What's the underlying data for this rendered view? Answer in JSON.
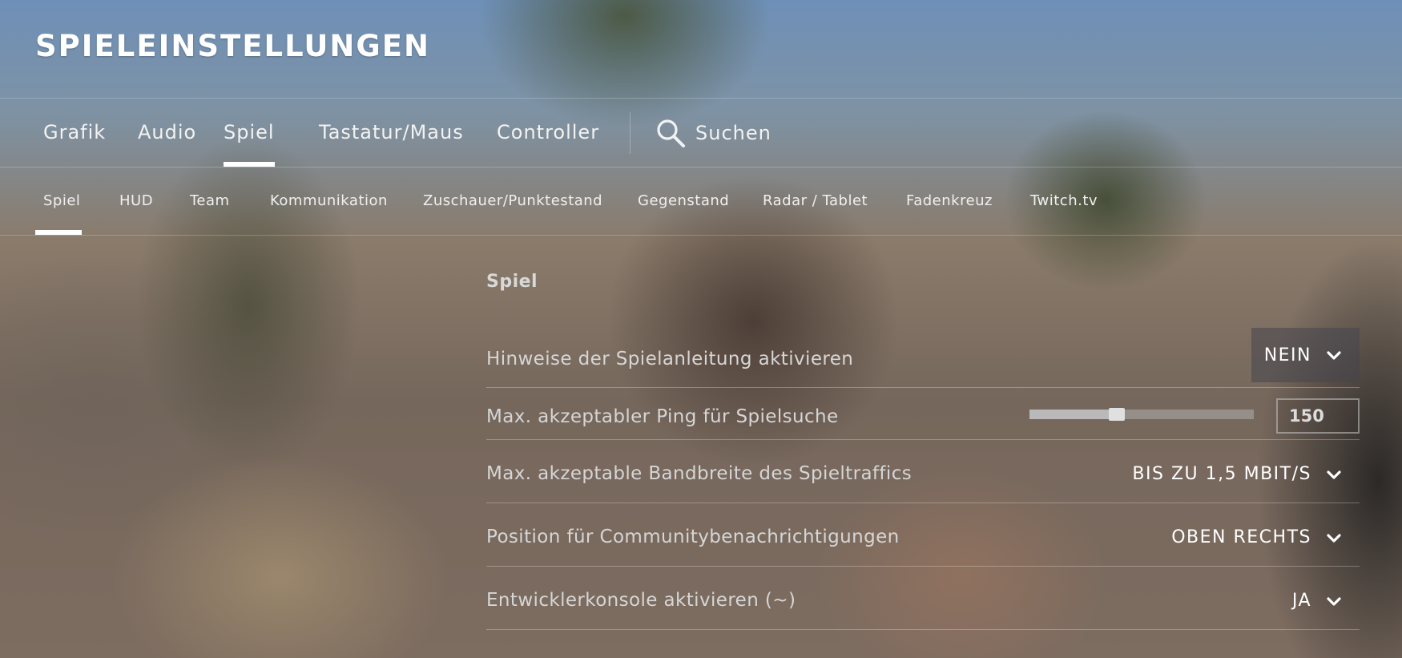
{
  "header": {
    "title": "SPIELEINSTELLUNGEN"
  },
  "main_tabs": [
    {
      "label": "Grafik",
      "active": false
    },
    {
      "label": "Audio",
      "active": false
    },
    {
      "label": "Spiel",
      "active": true
    },
    {
      "label": "Tastatur/Maus",
      "active": false
    },
    {
      "label": "Controller",
      "active": false
    }
  ],
  "search": {
    "label": "Suchen",
    "icon": "search-icon"
  },
  "sub_tabs": [
    {
      "label": "Spiel",
      "active": true
    },
    {
      "label": "HUD",
      "active": false
    },
    {
      "label": "Team",
      "active": false
    },
    {
      "label": "Kommunikation",
      "active": false
    },
    {
      "label": "Zuschauer/Punktestand",
      "active": false
    },
    {
      "label": "Gegenstand",
      "active": false
    },
    {
      "label": "Radar / Tablet",
      "active": false
    },
    {
      "label": "Fadenkreuz",
      "active": false
    },
    {
      "label": "Twitch.tv",
      "active": false
    }
  ],
  "section": {
    "heading": "Spiel"
  },
  "settings": [
    {
      "label": "Hinweise der Spielanleitung aktivieren",
      "control": "dropdown",
      "value": "NEIN"
    },
    {
      "label": "Max. akzeptabler Ping für Spielsuche",
      "control": "slider",
      "value": "150",
      "slider_fraction": 0.39
    },
    {
      "label": "Max. akzeptable Bandbreite des Spieltraffics",
      "control": "dropdown",
      "value": "BIS ZU 1,5 MBIT/S"
    },
    {
      "label": "Position für Communitybenachrichtigungen",
      "control": "dropdown",
      "value": "OBEN RECHTS"
    },
    {
      "label": "Entwicklerkonsole aktivieren (~)",
      "control": "dropdown",
      "value": "JA"
    }
  ],
  "colors": {
    "text": "#ffffff",
    "label": "#d6d6d6",
    "divider": "rgba(255,255,255,0.28)",
    "active_underline": "#ffffff"
  }
}
